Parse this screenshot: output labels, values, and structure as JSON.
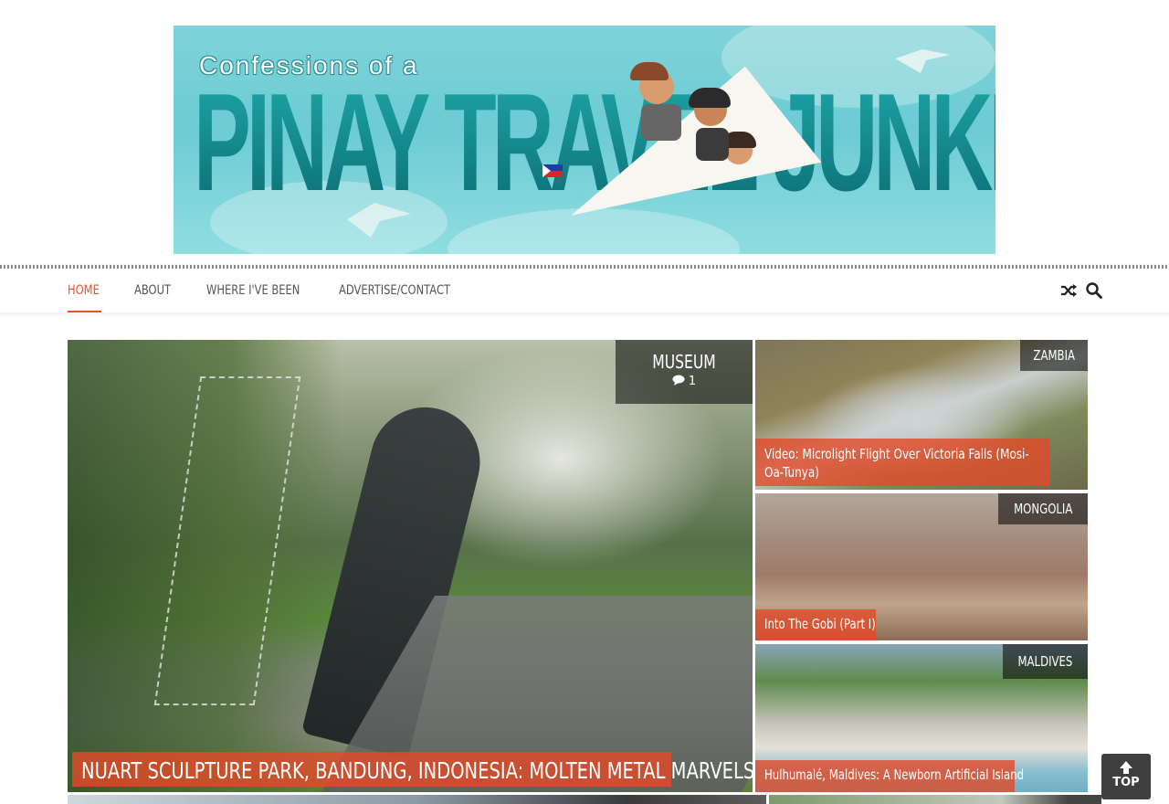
{
  "banner": {
    "line1": "Confessions of a",
    "line2": "PINAY TRAVEL JUNKIE"
  },
  "nav": {
    "items": [
      {
        "label": "HOME"
      },
      {
        "label": "ABOUT"
      },
      {
        "label": "WHERE I'VE BEEN"
      },
      {
        "label": "ADVERTISE/CONTACT"
      }
    ],
    "random_icon": "shuffle-icon",
    "search_icon": "search-icon"
  },
  "featured": {
    "main": {
      "category": "MUSEUM",
      "comments": "1",
      "title": "NUART SCULPTURE PARK, BANDUNG, INDONESIA: MOLTEN METAL MARVELS"
    },
    "side": [
      {
        "category": "ZAMBIA",
        "title": "Video: Microlight Flight Over Victoria Falls (Mosi-Oa-Tunya)"
      },
      {
        "category": "MONGOLIA",
        "title": "Into The Gobi (Part I)"
      },
      {
        "category": "MALDIVES",
        "title": "Hulhumalé, Maldives: A Newborn Artificial Island"
      }
    ]
  },
  "back_to_top": {
    "label": "TOP"
  },
  "colors": {
    "accent": "#e35235",
    "caption_bg": "#e24a28"
  }
}
